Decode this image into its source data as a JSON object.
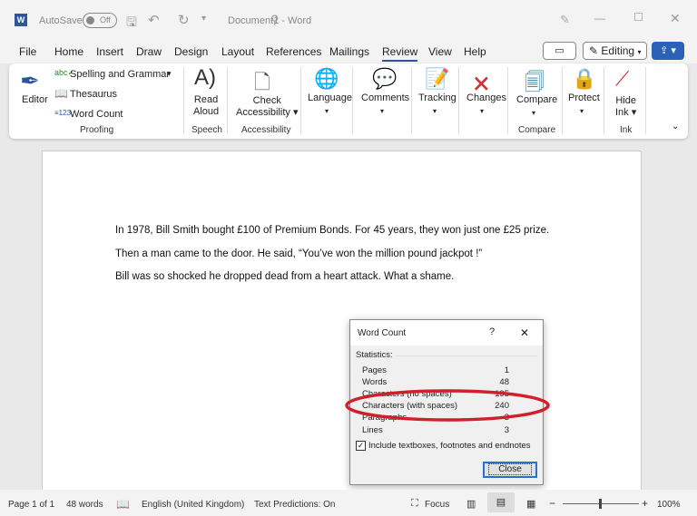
{
  "title_bar": {
    "app_icon": "word-icon",
    "autosave_label": "AutoSave",
    "autosave_state": "Off",
    "document_title": "Document1 - Word"
  },
  "menu_tabs": [
    "File",
    "Home",
    "Insert",
    "Draw",
    "Design",
    "Layout",
    "References",
    "Mailings",
    "Review",
    "View",
    "Help"
  ],
  "active_tab": "Review",
  "editing_label": "Editing",
  "ribbon": {
    "proofing": {
      "label": "Proofing",
      "editor": "Editor",
      "spelling": "Spelling and Grammar",
      "thesaurus": "Thesaurus",
      "word_count": "Word Count"
    },
    "speech": {
      "label": "Speech",
      "read_aloud_1": "Read",
      "read_aloud_2": "Aloud"
    },
    "accessibility": {
      "label": "Accessibility",
      "check_1": "Check",
      "check_2": "Accessibility"
    },
    "language": "Language",
    "comments": "Comments",
    "tracking": "Tracking",
    "changes": "Changes",
    "compare": {
      "label": "Compare",
      "button": "Compare"
    },
    "protect": "Protect",
    "ink": {
      "label": "Ink",
      "hide_1": "Hide",
      "hide_2": "Ink"
    }
  },
  "document": {
    "paragraphs": [
      "In 1978, Bill Smith bought £100 of Premium Bonds. For 45 years, they won just one £25 prize.",
      "Then a man came to the door. He said, “You’ve won the million pound jackpot !”",
      "Bill was so shocked he dropped dead from a heart attack. What a shame."
    ]
  },
  "word_count_dialog": {
    "title": "Word Count",
    "help": "?",
    "close_x": "✕",
    "statistics_label": "Statistics:",
    "rows": [
      {
        "label": "Pages",
        "value": "1"
      },
      {
        "label": "Words",
        "value": "48"
      },
      {
        "label": "Characters (no spaces)",
        "value": "195"
      },
      {
        "label": "Characters (with spaces)",
        "value": "240"
      },
      {
        "label": "Paragraphs",
        "value": "3"
      },
      {
        "label": "Lines",
        "value": "3"
      }
    ],
    "include_checkbox": "Include textboxes, footnotes and endnotes",
    "include_checked": true,
    "close_button": "Close",
    "highlight_color": "#d0202a"
  },
  "status_bar": {
    "page": "Page 1 of 1",
    "words": "48 words",
    "language": "English (United Kingdom)",
    "text_predictions": "Text Predictions: On",
    "focus": "Focus",
    "zoom": "100%",
    "zoom_level_percent": 100
  }
}
